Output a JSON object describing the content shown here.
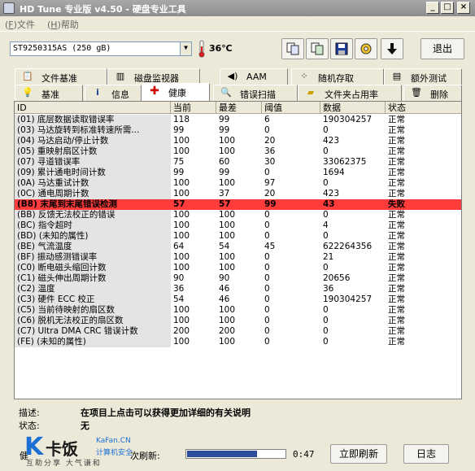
{
  "window": {
    "title": "HD Tune 专业版 v4.50 - 硬盘专业工具"
  },
  "menu": {
    "file": "文件",
    "file_key": "F",
    "help": "帮助",
    "help_key": "H"
  },
  "toolbar": {
    "drive": "ST9250315AS (250 gB)",
    "temperature": "36℃",
    "exit_label": "退出",
    "icons": [
      "copy-text-icon",
      "copy-screen-icon",
      "save-icon",
      "options-icon",
      "down-arrow-icon"
    ]
  },
  "tabs": {
    "row1": [
      {
        "label": "文件基准",
        "icon": "file-benchmark-icon"
      },
      {
        "label": "磁盘监视器",
        "icon": "disk-monitor-icon"
      },
      {
        "label": "AAM",
        "icon": "speaker-icon"
      },
      {
        "label": "随机存取",
        "icon": "random-access-icon"
      },
      {
        "label": "额外测试",
        "icon": "extra-tests-icon"
      }
    ],
    "row2": [
      {
        "label": "基准",
        "icon": "benchmark-icon"
      },
      {
        "label": "信息",
        "icon": "info-icon"
      },
      {
        "label": "健康",
        "icon": "health-cross-icon",
        "active": true
      },
      {
        "label": "错误扫描",
        "icon": "error-scan-icon"
      },
      {
        "label": "文件夹占用率",
        "icon": "folder-usage-icon"
      },
      {
        "label": "删除",
        "icon": "erase-icon"
      }
    ]
  },
  "table": {
    "headers": [
      "ID",
      "当前",
      "最差",
      "阈值",
      "数据",
      "状态"
    ],
    "rows": [
      {
        "id": "(01) 底层数据读取错误率",
        "current": "118",
        "worst": "99",
        "threshold": "6",
        "data": "190304257",
        "status": "正常"
      },
      {
        "id": "(03) 马达旋转到标准转速所需...",
        "current": "99",
        "worst": "99",
        "threshold": "0",
        "data": "0",
        "status": "正常"
      },
      {
        "id": "(04) 马达启动/停止计数",
        "current": "100",
        "worst": "100",
        "threshold": "20",
        "data": "423",
        "status": "正常"
      },
      {
        "id": "(05) 重映射扇区计数",
        "current": "100",
        "worst": "100",
        "threshold": "36",
        "data": "0",
        "status": "正常"
      },
      {
        "id": "(07) 寻道错误率",
        "current": "75",
        "worst": "60",
        "threshold": "30",
        "data": "33062375",
        "status": "正常"
      },
      {
        "id": "(09) 累计通电时间计数",
        "current": "99",
        "worst": "99",
        "threshold": "0",
        "data": "1694",
        "status": "正常"
      },
      {
        "id": "(0A) 马达重试计数",
        "current": "100",
        "worst": "100",
        "threshold": "97",
        "data": "0",
        "status": "正常"
      },
      {
        "id": "(0C) 通电周期计数",
        "current": "100",
        "worst": "37",
        "threshold": "20",
        "data": "423",
        "status": "正常"
      },
      {
        "id": "(B8) 末尾到末尾错误检测",
        "current": "57",
        "worst": "57",
        "threshold": "99",
        "data": "43",
        "status": "失败",
        "failed": true
      },
      {
        "id": "(BB) 反馈无法校正的错误",
        "current": "100",
        "worst": "100",
        "threshold": "0",
        "data": "0",
        "status": "正常"
      },
      {
        "id": "(BC) 指令超时",
        "current": "100",
        "worst": "100",
        "threshold": "0",
        "data": "4",
        "status": "正常"
      },
      {
        "id": "(BD) (未知的属性)",
        "current": "100",
        "worst": "100",
        "threshold": "0",
        "data": "0",
        "status": "正常"
      },
      {
        "id": "(BE) 气流温度",
        "current": "64",
        "worst": "54",
        "threshold": "45",
        "data": "622264356",
        "status": "正常"
      },
      {
        "id": "(BF) 振动感测错误率",
        "current": "100",
        "worst": "100",
        "threshold": "0",
        "data": "21",
        "status": "正常"
      },
      {
        "id": "(C0) 断电磁头缩回计数",
        "current": "100",
        "worst": "100",
        "threshold": "0",
        "data": "0",
        "status": "正常"
      },
      {
        "id": "(C1) 磁头伸出周期计数",
        "current": "90",
        "worst": "90",
        "threshold": "0",
        "data": "20656",
        "status": "正常"
      },
      {
        "id": "(C2) 温度",
        "current": "36",
        "worst": "46",
        "threshold": "0",
        "data": "36",
        "status": "正常"
      },
      {
        "id": "(C3) 硬件 ECC 校正",
        "current": "54",
        "worst": "46",
        "threshold": "0",
        "data": "190304257",
        "status": "正常"
      },
      {
        "id": "(C5) 当前待映射的扇区数",
        "current": "100",
        "worst": "100",
        "threshold": "0",
        "data": "0",
        "status": "正常"
      },
      {
        "id": "(C6) 脱机无法校正的扇区数",
        "current": "100",
        "worst": "100",
        "threshold": "0",
        "data": "0",
        "status": "正常"
      },
      {
        "id": "(C7) Ultra DMA CRC 错误计数",
        "current": "200",
        "worst": "200",
        "threshold": "0",
        "data": "0",
        "status": "正常"
      },
      {
        "id": "(FE) (未知的属性)",
        "current": "100",
        "worst": "100",
        "threshold": "0",
        "data": "0",
        "status": "正常"
      }
    ]
  },
  "info": {
    "desc_label": "描述:",
    "desc_value": "在项目上点击可以获得更加详细的有关说明",
    "status_label": "状态:",
    "status_value": "无"
  },
  "bottom": {
    "health_label": "健",
    "refresh_label": "次刷新:",
    "progress": 0.72,
    "timer": "0:47",
    "refresh_btn": "立即刷新",
    "log_btn": "日志"
  },
  "watermark": {
    "k": "K",
    "name": "卡饭",
    "site": "KaFan.CN",
    "sub": "计算机安全",
    "slogan": "互助分享  大气谦和"
  },
  "colors": {
    "fail_row": "#ff3b3b",
    "status_ok_bg": "#ffffff",
    "progress": "#2d4f9b"
  }
}
